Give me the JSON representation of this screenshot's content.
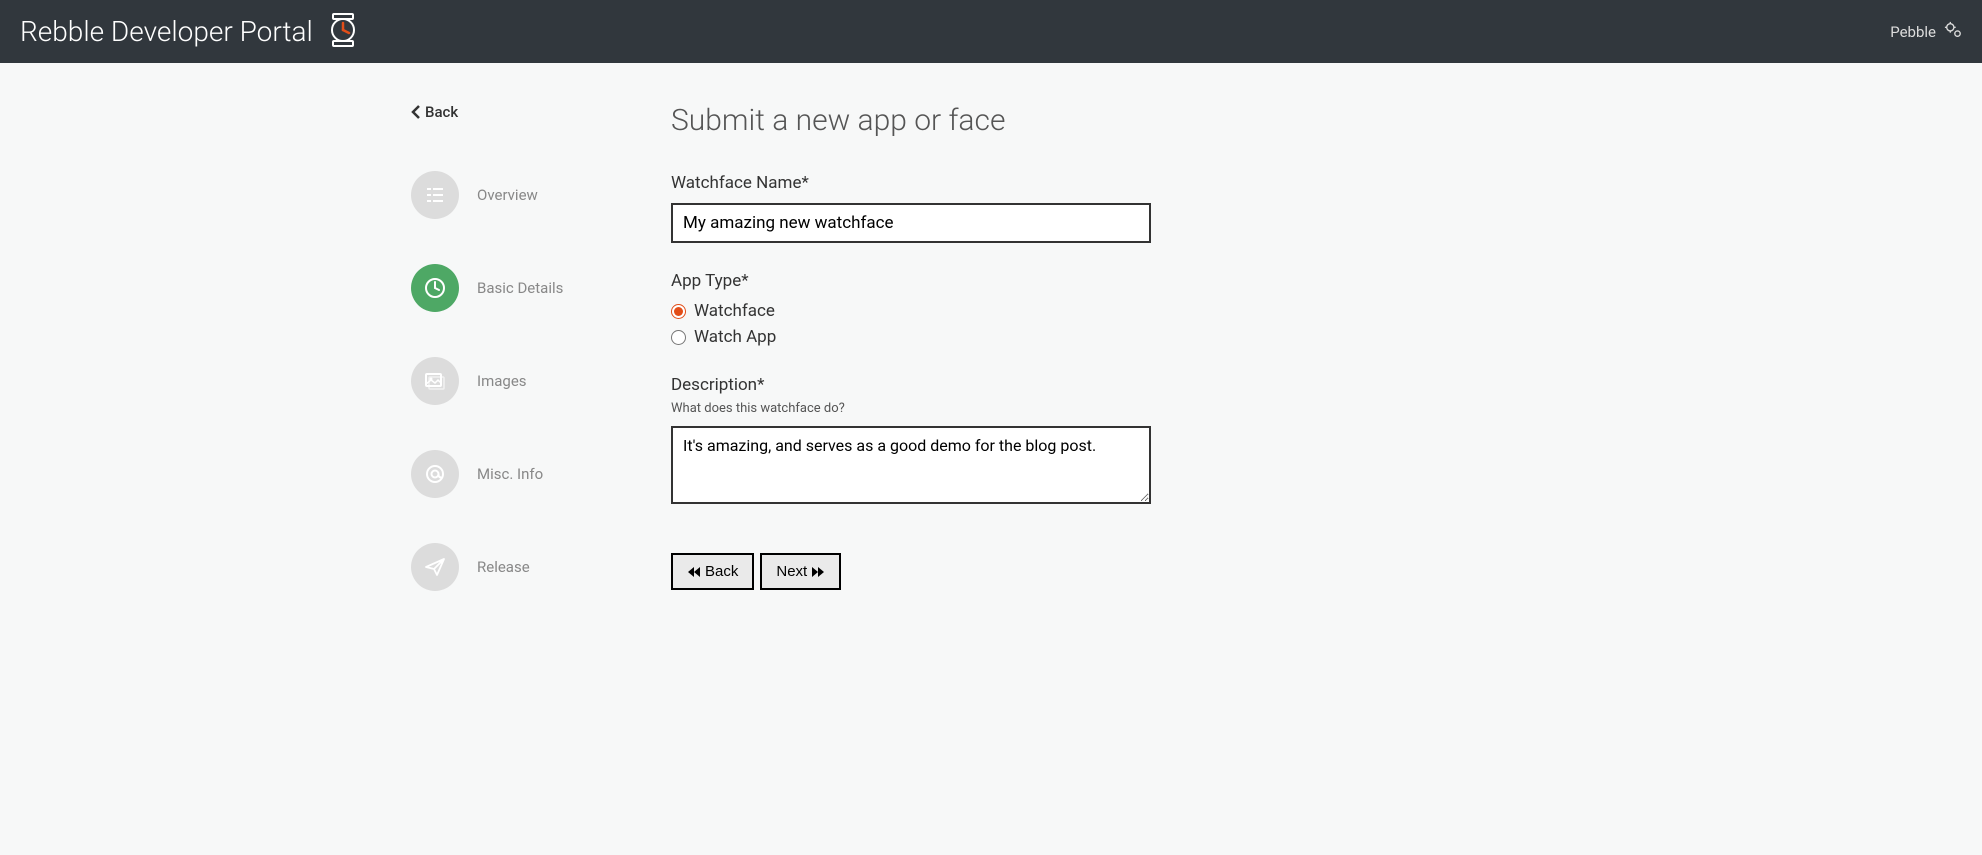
{
  "header": {
    "title": "Rebble Developer Portal",
    "user_label": "Pebble"
  },
  "sidebar": {
    "back_label": "Back",
    "steps": [
      {
        "label": "Overview",
        "icon": "list",
        "active": false
      },
      {
        "label": "Basic Details",
        "icon": "clock",
        "active": true
      },
      {
        "label": "Images",
        "icon": "image",
        "active": false
      },
      {
        "label": "Misc. Info",
        "icon": "at",
        "active": false
      },
      {
        "label": "Release",
        "icon": "plane",
        "active": false
      }
    ]
  },
  "main": {
    "title": "Submit a new app or face",
    "fields": {
      "name_label": "Watchface Name*",
      "name_value": "My amazing new watchface",
      "type_label": "App Type*",
      "type_options": [
        {
          "label": "Watchface",
          "checked": true
        },
        {
          "label": "Watch App",
          "checked": false
        }
      ],
      "description_label": "Description*",
      "description_help": "What does this watchface do?",
      "description_value": "It's amazing, and serves as a good demo for the blog post."
    },
    "buttons": {
      "back": "Back",
      "next": "Next"
    }
  }
}
